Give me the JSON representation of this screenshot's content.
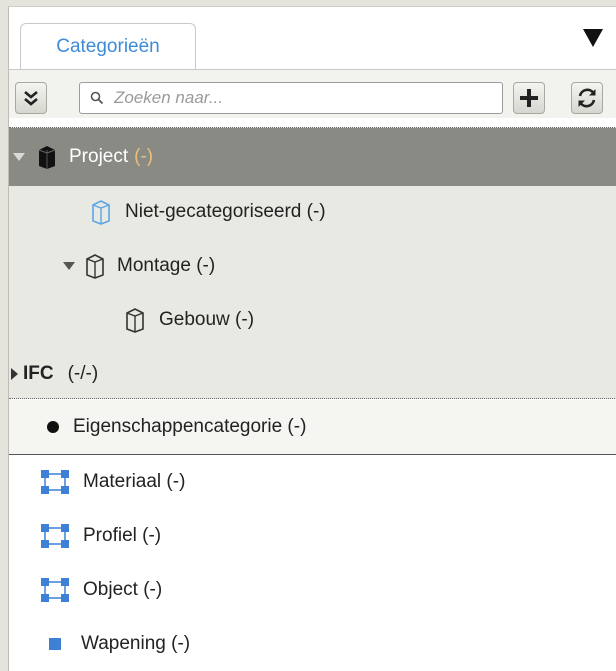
{
  "tabs": {
    "active_label": "Categorieën"
  },
  "search": {
    "placeholder": "Zoeken naar..."
  },
  "tree": {
    "project": {
      "label": "Project",
      "count": "(-)"
    },
    "niet_gecategoriseerd": {
      "label": "Niet-gecategoriseerd (-)"
    },
    "montage": {
      "label": "Montage (-)"
    },
    "gebouw": {
      "label": "Gebouw (-)"
    },
    "ifc": {
      "label": "IFC",
      "count": "(-/-)"
    }
  },
  "property_category": {
    "label": "Eigenschappencategorie (-)"
  },
  "list": {
    "materiaal": {
      "label": "Materiaal (-)"
    },
    "profiel": {
      "label": "Profiel (-)"
    },
    "object": {
      "label": "Object (-)"
    },
    "wapening": {
      "label": "Wapening (-)"
    }
  },
  "colors": {
    "accent": "#3d8bd7",
    "selected_row": "#8a8a85",
    "tree_bg": "#e9e9e3",
    "object_icon": "#3d80d6"
  }
}
